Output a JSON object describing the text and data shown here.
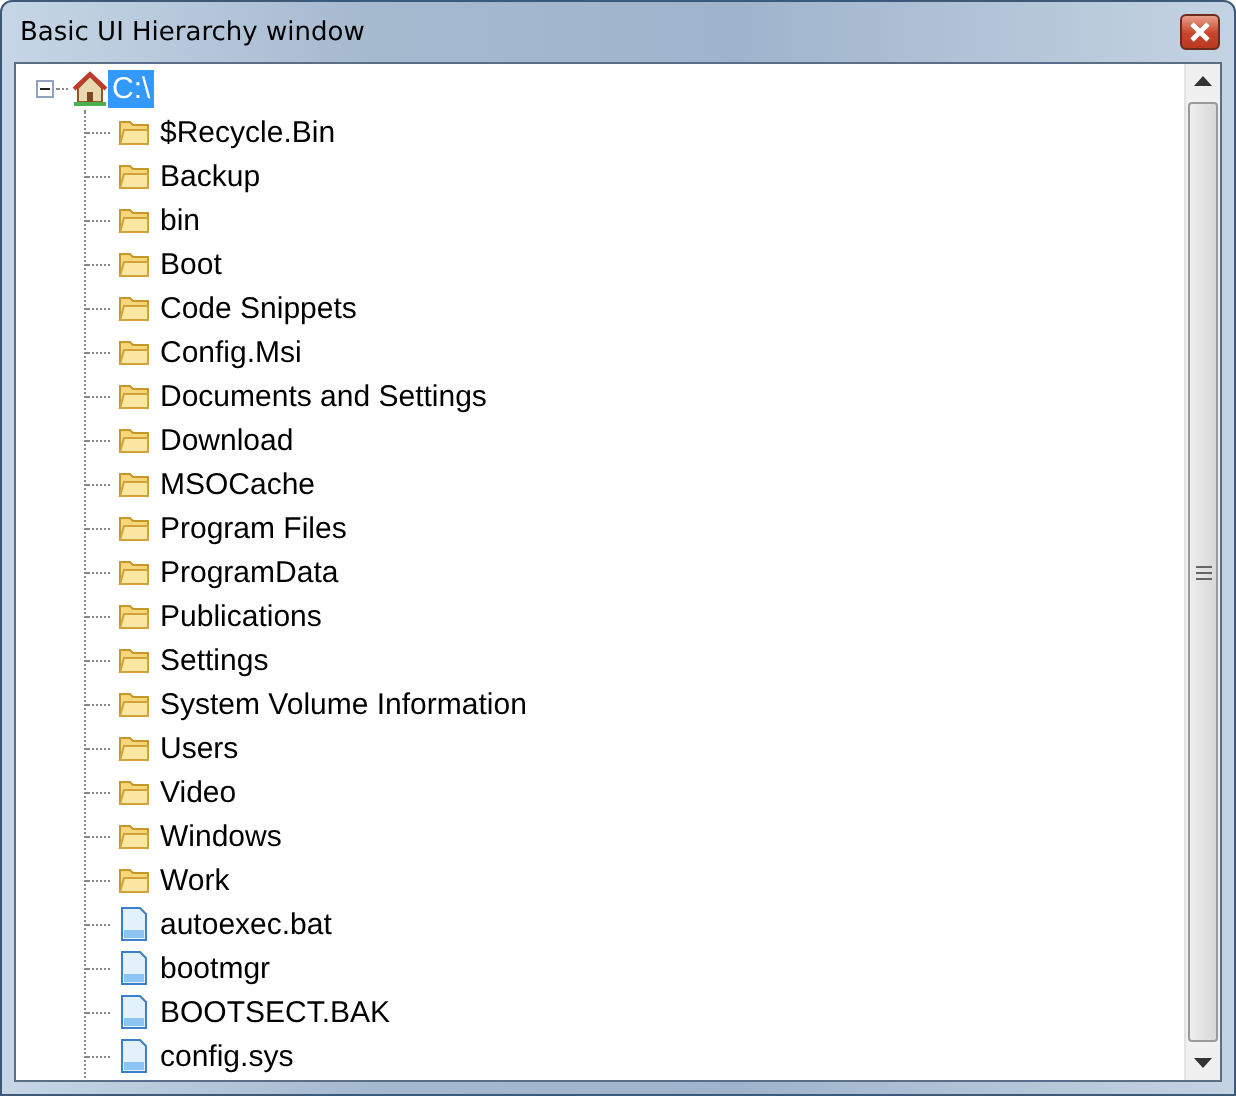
{
  "window": {
    "title": "Basic UI Hierarchy window"
  },
  "tree": {
    "label": "C:\\",
    "selected": true,
    "expanded": true,
    "children": [
      {
        "label": "$Recycle.Bin",
        "kind": "folder",
        "selected": false
      },
      {
        "label": "Backup",
        "kind": "folder",
        "selected": false
      },
      {
        "label": "bin",
        "kind": "folder",
        "selected": false
      },
      {
        "label": "Boot",
        "kind": "folder",
        "selected": false
      },
      {
        "label": "Code Snippets",
        "kind": "folder",
        "selected": false
      },
      {
        "label": "Config.Msi",
        "kind": "folder",
        "selected": false
      },
      {
        "label": "Documents and Settings",
        "kind": "folder",
        "selected": false
      },
      {
        "label": "Download",
        "kind": "folder",
        "selected": false
      },
      {
        "label": "MSOCache",
        "kind": "folder",
        "selected": false
      },
      {
        "label": "Program Files",
        "kind": "folder",
        "selected": false
      },
      {
        "label": "ProgramData",
        "kind": "folder",
        "selected": false
      },
      {
        "label": "Publications",
        "kind": "folder",
        "selected": false
      },
      {
        "label": "Settings",
        "kind": "folder",
        "selected": false
      },
      {
        "label": "System Volume Information",
        "kind": "folder",
        "selected": false
      },
      {
        "label": "Users",
        "kind": "folder",
        "selected": false
      },
      {
        "label": "Video",
        "kind": "folder",
        "selected": false
      },
      {
        "label": "Windows",
        "kind": "folder",
        "selected": false
      },
      {
        "label": "Work",
        "kind": "folder",
        "selected": false
      },
      {
        "label": "autoexec.bat",
        "kind": "file",
        "selected": false
      },
      {
        "label": "bootmgr",
        "kind": "file",
        "selected": false
      },
      {
        "label": "BOOTSECT.BAK",
        "kind": "file",
        "selected": false
      },
      {
        "label": "config.sys",
        "kind": "file",
        "selected": false
      }
    ]
  }
}
